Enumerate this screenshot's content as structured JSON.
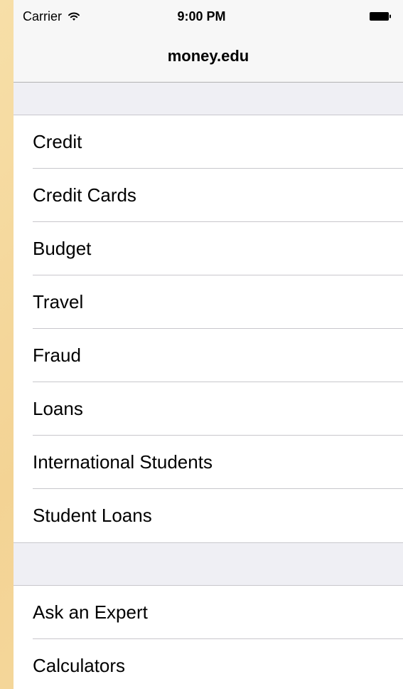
{
  "status_bar": {
    "carrier": "Carrier",
    "time": "9:00 PM"
  },
  "nav_bar": {
    "title": "money.edu"
  },
  "sections": [
    {
      "items": [
        {
          "label": "Credit"
        },
        {
          "label": "Credit Cards"
        },
        {
          "label": "Budget"
        },
        {
          "label": "Travel"
        },
        {
          "label": "Fraud"
        },
        {
          "label": "Loans"
        },
        {
          "label": "International Students"
        },
        {
          "label": "Student Loans"
        }
      ]
    },
    {
      "items": [
        {
          "label": "Ask an Expert"
        },
        {
          "label": "Calculators"
        }
      ]
    }
  ],
  "icons": {
    "wifi": "wifi-icon",
    "battery": "battery-icon"
  },
  "colors": {
    "background": "#f5d89d",
    "table_bg": "#efeff4",
    "cell_bg": "#ffffff",
    "separator": "#c8c7cc",
    "bar_bg": "#f7f7f7",
    "text": "#000000"
  }
}
